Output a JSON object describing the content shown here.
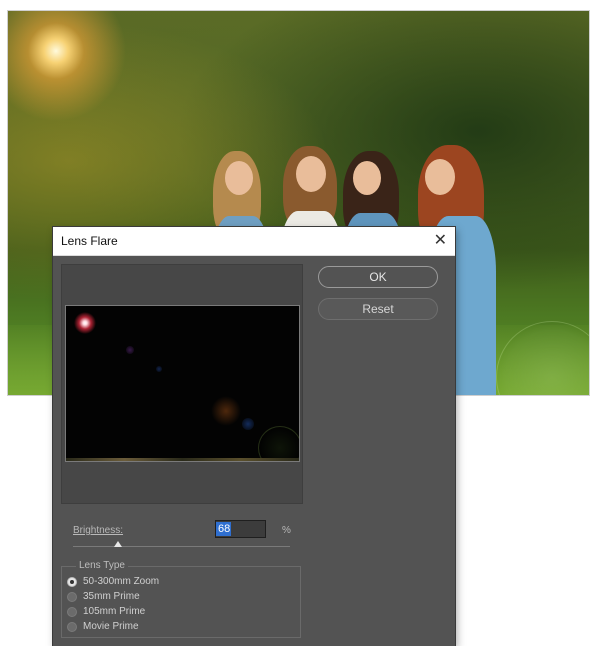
{
  "dialog": {
    "title": "Lens Flare",
    "close_glyph": "✕",
    "ok_label": "OK",
    "reset_label": "Reset"
  },
  "brightness": {
    "label": "Brightness:",
    "value": "68",
    "unit": "%"
  },
  "lens_type": {
    "legend": "Lens Type",
    "options": [
      {
        "label": "50-300mm Zoom",
        "checked": true
      },
      {
        "label": "35mm Prime",
        "checked": false
      },
      {
        "label": "105mm Prime",
        "checked": false
      },
      {
        "label": "Movie Prime",
        "checked": false
      }
    ]
  },
  "icons": {
    "close": "close-icon",
    "slider": "slider-thumb-icon",
    "radio": "radio-icon"
  },
  "colors": {
    "dialog_bg": "#535353",
    "selection": "#2f6fd0",
    "flare": "#c8283c"
  }
}
